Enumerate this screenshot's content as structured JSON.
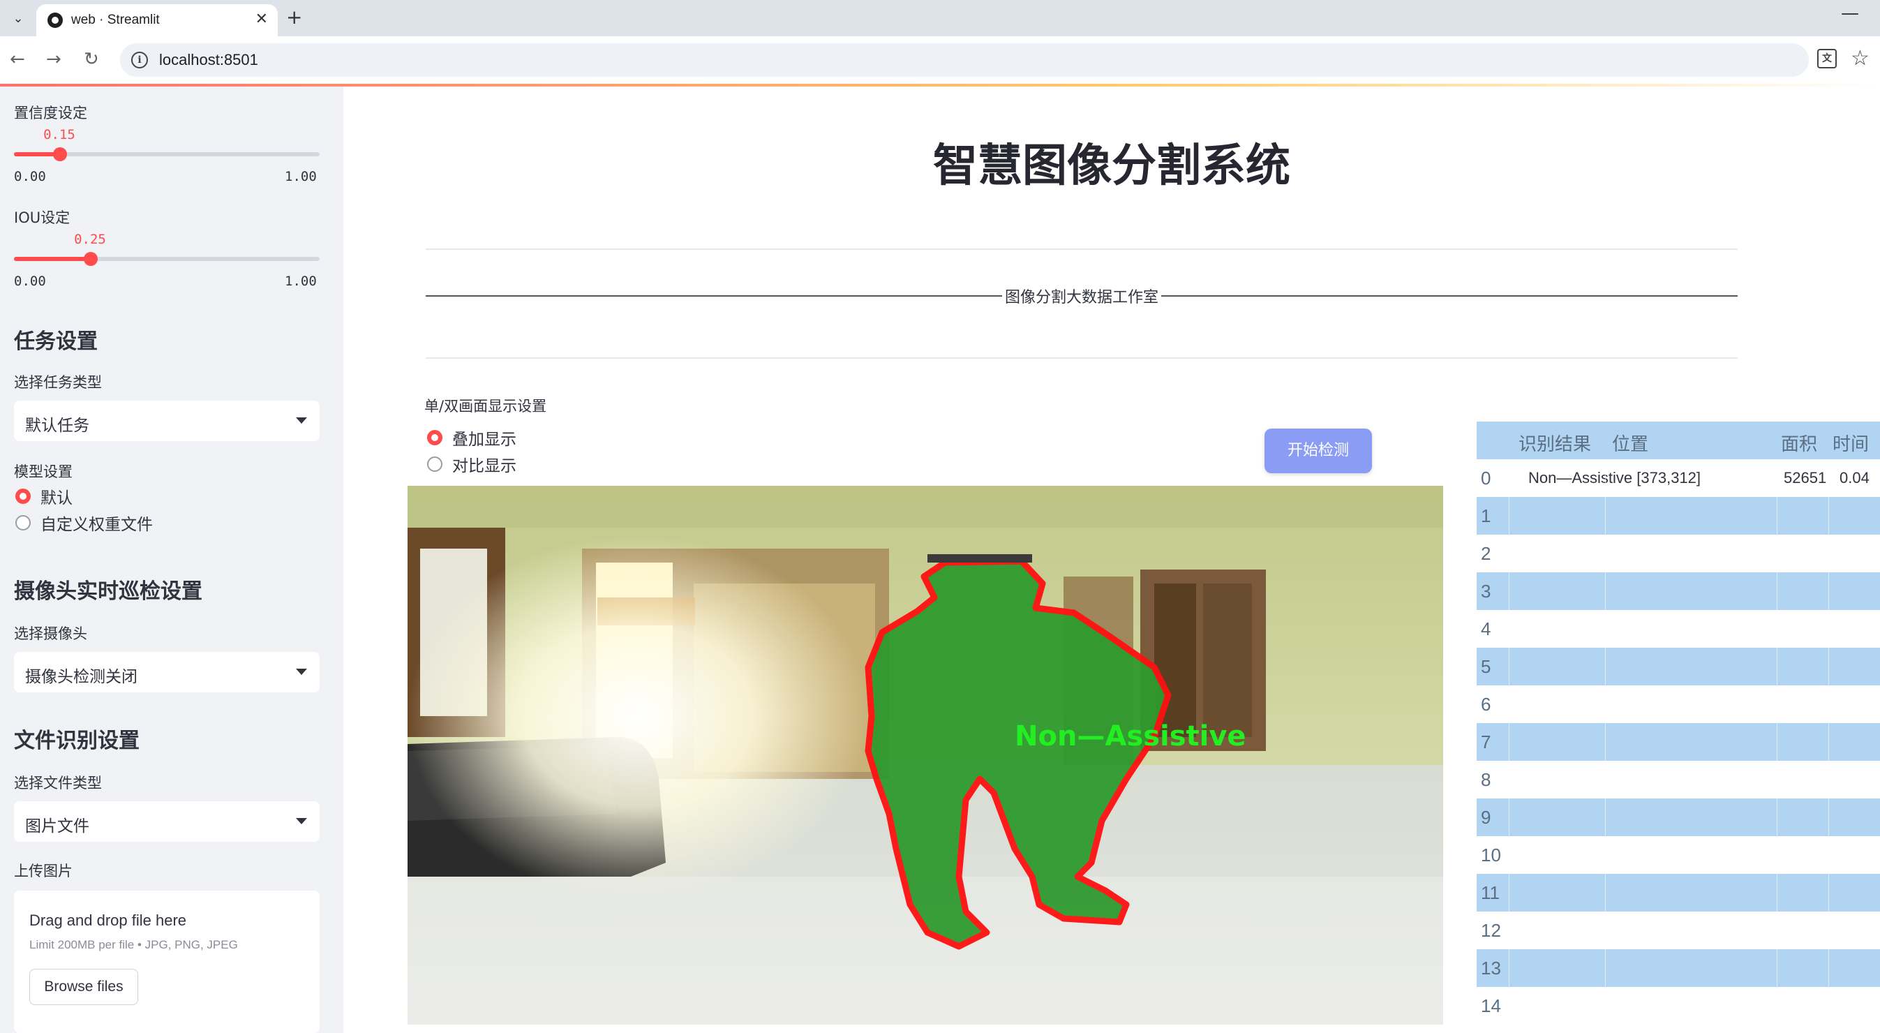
{
  "browser": {
    "tab_title": "web · Streamlit",
    "url": "localhost:8501"
  },
  "sidebar": {
    "confidence": {
      "label": "置信度设定",
      "value": "0.15",
      "value_num": 0.15,
      "min": "0.00",
      "max": "1.00"
    },
    "iou": {
      "label": "IOU设定",
      "value": "0.25",
      "value_num": 0.25,
      "min": "0.00",
      "max": "1.00"
    },
    "task_heading": "任务设置",
    "task_type_label": "选择任务类型",
    "task_type_value": "默认任务",
    "model_label": "模型设置",
    "model_options": [
      "默认",
      "自定义权重文件"
    ],
    "model_selected": "默认",
    "camera_heading": "摄像头实时巡检设置",
    "camera_label": "选择摄像头",
    "camera_value": "摄像头检测关闭",
    "file_heading": "文件识别设置",
    "file_type_label": "选择文件类型",
    "file_type_value": "图片文件",
    "upload_label": "上传图片",
    "upload_drag": "Drag and drop file here",
    "upload_limit": "Limit 200MB per file • JPG, PNG, JPEG",
    "upload_button": "Browse files"
  },
  "main": {
    "title": "智慧图像分割系统",
    "studio": "图像分割大数据工作室",
    "display_label": "单/双画面显示设置",
    "display_options": [
      "叠加显示",
      "对比显示"
    ],
    "display_selected": "叠加显示",
    "start_button": "开始检测",
    "detection_label": "Non—Assistive"
  },
  "table": {
    "columns": [
      "识别结果",
      "位置",
      "面积",
      "时间"
    ],
    "row_indices": [
      "0",
      "1",
      "2",
      "3",
      "4",
      "5",
      "6",
      "7",
      "8",
      "9",
      "10",
      "11",
      "12",
      "13",
      "14"
    ],
    "rows": [
      {
        "result": "Non—Assistive",
        "position": "[373,312]",
        "area": "52651",
        "time": "0.04"
      }
    ]
  },
  "colors": {
    "accent": "#ff4b4b",
    "sidebar_bg": "#f0f2f6",
    "button_bg": "#8b9cf5",
    "table_stripe": "#b0d4f1",
    "mask_fill": "#2f9a2f",
    "mask_outline": "#ff1010",
    "label_green": "#22ee22"
  }
}
